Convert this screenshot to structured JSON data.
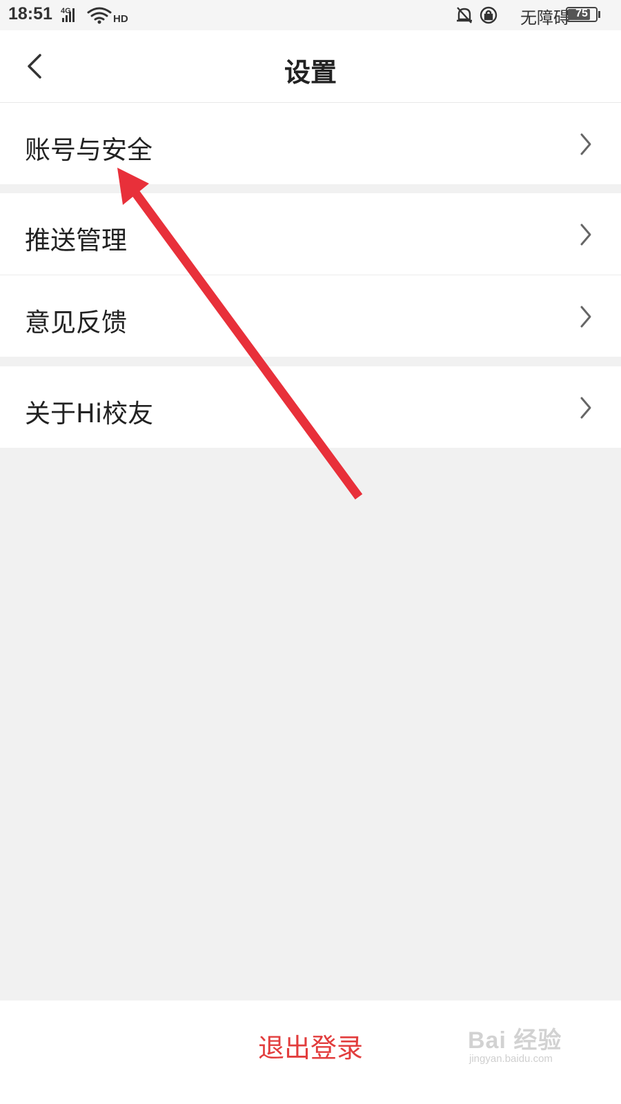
{
  "status_bar": {
    "time": "18:51",
    "network": "4G",
    "hd_label": "HD",
    "accessibility_label": "无障碍",
    "battery_level": "75"
  },
  "header": {
    "title": "设置"
  },
  "groups": [
    {
      "items": [
        {
          "label": "账号与安全"
        }
      ]
    },
    {
      "items": [
        {
          "label": "推送管理"
        },
        {
          "label": "意见反馈"
        }
      ]
    },
    {
      "items": [
        {
          "label": "关于Hi校友"
        }
      ]
    }
  ],
  "logout": {
    "label": "退出登录",
    "color": "#e23d3d"
  },
  "watermark": {
    "main": "Bai 经验",
    "sub": "jingyan.baidu.com"
  },
  "annotation": {
    "color": "#e8303a"
  }
}
